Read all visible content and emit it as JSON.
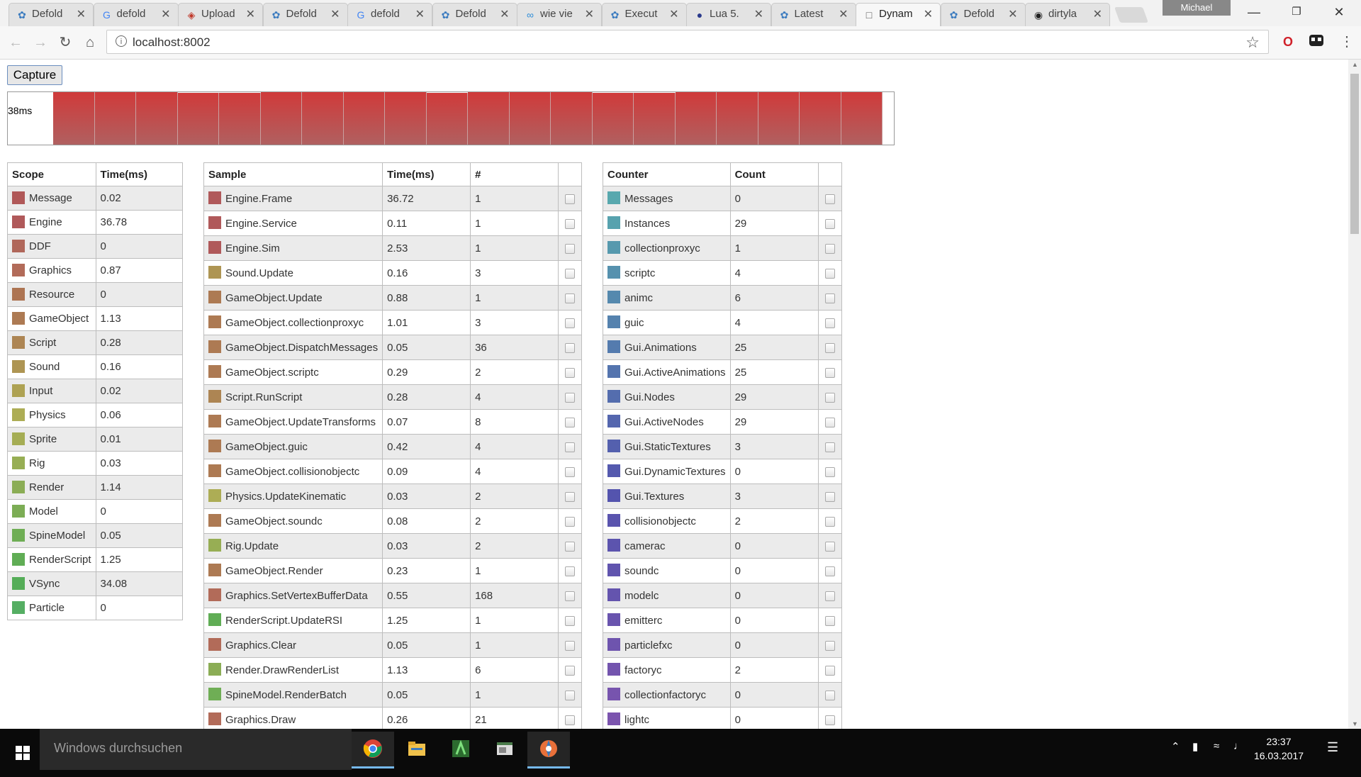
{
  "browser": {
    "tabs": [
      {
        "title": "Defold",
        "icon": "defold"
      },
      {
        "title": "defold",
        "icon": "google"
      },
      {
        "title": "Upload",
        "icon": "shield"
      },
      {
        "title": "Defold",
        "icon": "defold"
      },
      {
        "title": "defold",
        "icon": "google"
      },
      {
        "title": "Defold",
        "icon": "defold"
      },
      {
        "title": "wie vie",
        "icon": "infinity"
      },
      {
        "title": "Execut",
        "icon": "defold"
      },
      {
        "title": "Lua 5.",
        "icon": "lua"
      },
      {
        "title": "Latest",
        "icon": "defold"
      },
      {
        "title": "Dynam",
        "icon": "page"
      },
      {
        "title": "Defold",
        "icon": "defold"
      },
      {
        "title": "dirtyla",
        "icon": "github"
      }
    ],
    "active_tab_index": 10,
    "profile_name": "Michael",
    "url": "localhost:8002"
  },
  "profiler": {
    "capture_label": "Capture",
    "frame_label": "38ms",
    "frame_heights": [
      1,
      1,
      1,
      0.98,
      0.98,
      1,
      1,
      1,
      1,
      0.98,
      1,
      1,
      1,
      0.98,
      0.98,
      1,
      1,
      1,
      1,
      1
    ],
    "scope_table": {
      "headers": [
        "Scope",
        "Time(ms)"
      ],
      "rows": [
        {
          "name": "Message",
          "value": "0.02",
          "color": "#b05858"
        },
        {
          "name": "Engine",
          "value": "36.78",
          "color": "#b0595a"
        },
        {
          "name": "DDF",
          "value": "0",
          "color": "#b0675a"
        },
        {
          "name": "Graphics",
          "value": "0.87",
          "color": "#b26b59"
        },
        {
          "name": "Resource",
          "value": "0",
          "color": "#ad7452"
        },
        {
          "name": "GameObject",
          "value": "1.13",
          "color": "#ad7a53"
        },
        {
          "name": "Script",
          "value": "0.28",
          "color": "#ad8553"
        },
        {
          "name": "Sound",
          "value": "0.16",
          "color": "#ae9553"
        },
        {
          "name": "Input",
          "value": "0.02",
          "color": "#aea253"
        },
        {
          "name": "Physics",
          "value": "0.06",
          "color": "#adad55"
        },
        {
          "name": "Sprite",
          "value": "0.01",
          "color": "#a5ad54"
        },
        {
          "name": "Rig",
          "value": "0.03",
          "color": "#97ae54"
        },
        {
          "name": "Render",
          "value": "1.14",
          "color": "#8bad55"
        },
        {
          "name": "Model",
          "value": "0",
          "color": "#7cad55"
        },
        {
          "name": "SpineModel",
          "value": "0.05",
          "color": "#6fae55"
        },
        {
          "name": "RenderScript",
          "value": "1.25",
          "color": "#60ad55"
        },
        {
          "name": "VSync",
          "value": "34.08",
          "color": "#55ad58"
        },
        {
          "name": "Particle",
          "value": "0",
          "color": "#55ae63"
        }
      ]
    },
    "sample_table": {
      "headers": [
        "Sample",
        "Time(ms)",
        "#",
        ""
      ],
      "rows": [
        {
          "name": "Engine.Frame",
          "time": "36.72",
          "count": "1",
          "color": "#b0595a"
        },
        {
          "name": "Engine.Service",
          "time": "0.11",
          "count": "1",
          "color": "#b0595a"
        },
        {
          "name": "Engine.Sim",
          "time": "2.53",
          "count": "1",
          "color": "#b0595a"
        },
        {
          "name": "Sound.Update",
          "time": "0.16",
          "count": "3",
          "color": "#ae9553"
        },
        {
          "name": "GameObject.Update",
          "time": "0.88",
          "count": "1",
          "color": "#ad7a53"
        },
        {
          "name": "GameObject.collectionproxyc",
          "time": "1.01",
          "count": "3",
          "color": "#ad7a53"
        },
        {
          "name": "GameObject.DispatchMessages",
          "time": "0.05",
          "count": "36",
          "color": "#ad7a53"
        },
        {
          "name": "GameObject.scriptc",
          "time": "0.29",
          "count": "2",
          "color": "#ad7a53"
        },
        {
          "name": "Script.RunScript",
          "time": "0.28",
          "count": "4",
          "color": "#ad8553"
        },
        {
          "name": "GameObject.UpdateTransforms",
          "time": "0.07",
          "count": "8",
          "color": "#ad7a53"
        },
        {
          "name": "GameObject.guic",
          "time": "0.42",
          "count": "4",
          "color": "#ad7a53"
        },
        {
          "name": "GameObject.collisionobjectc",
          "time": "0.09",
          "count": "4",
          "color": "#ad7a53"
        },
        {
          "name": "Physics.UpdateKinematic",
          "time": "0.03",
          "count": "2",
          "color": "#adad55"
        },
        {
          "name": "GameObject.soundc",
          "time": "0.08",
          "count": "2",
          "color": "#ad7a53"
        },
        {
          "name": "Rig.Update",
          "time": "0.03",
          "count": "2",
          "color": "#97ae54"
        },
        {
          "name": "GameObject.Render",
          "time": "0.23",
          "count": "1",
          "color": "#ad7a53"
        },
        {
          "name": "Graphics.SetVertexBufferData",
          "time": "0.55",
          "count": "168",
          "color": "#b26b59"
        },
        {
          "name": "RenderScript.UpdateRSI",
          "time": "1.25",
          "count": "1",
          "color": "#60ad55"
        },
        {
          "name": "Graphics.Clear",
          "time": "0.05",
          "count": "1",
          "color": "#b26b59"
        },
        {
          "name": "Render.DrawRenderList",
          "time": "1.13",
          "count": "6",
          "color": "#8bad55"
        },
        {
          "name": "SpineModel.RenderBatch",
          "time": "0.05",
          "count": "1",
          "color": "#6fae55"
        },
        {
          "name": "Graphics.Draw",
          "time": "0.26",
          "count": "21",
          "color": "#b26b59"
        }
      ]
    },
    "counter_table": {
      "headers": [
        "Counter",
        "Count",
        ""
      ],
      "rows": [
        {
          "name": "Messages",
          "value": "0",
          "color": "#58a8ae"
        },
        {
          "name": "Instances",
          "value": "29",
          "color": "#57a2ae"
        },
        {
          "name": "collectionproxyc",
          "value": "1",
          "color": "#5699ae"
        },
        {
          "name": "scriptc",
          "value": "4",
          "color": "#5691ae"
        },
        {
          "name": "animc",
          "value": "6",
          "color": "#5589ae"
        },
        {
          "name": "guic",
          "value": "4",
          "color": "#5582ae"
        },
        {
          "name": "Gui.Animations",
          "value": "25",
          "color": "#547bae"
        },
        {
          "name": "Gui.ActiveAnimations",
          "value": "25",
          "color": "#5474ae"
        },
        {
          "name": "Gui.Nodes",
          "value": "29",
          "color": "#546dae"
        },
        {
          "name": "Gui.ActiveNodes",
          "value": "29",
          "color": "#5466ae"
        },
        {
          "name": "Gui.StaticTextures",
          "value": "3",
          "color": "#5460ae"
        },
        {
          "name": "Gui.DynamicTextures",
          "value": "0",
          "color": "#5459ae"
        },
        {
          "name": "Gui.Textures",
          "value": "3",
          "color": "#5454ae"
        },
        {
          "name": "collisionobjectc",
          "value": "2",
          "color": "#5a54ae"
        },
        {
          "name": "camerac",
          "value": "0",
          "color": "#5c54ae"
        },
        {
          "name": "soundc",
          "value": "0",
          "color": "#6054ae"
        },
        {
          "name": "modelc",
          "value": "0",
          "color": "#6454ae"
        },
        {
          "name": "emitterc",
          "value": "0",
          "color": "#6954ae"
        },
        {
          "name": "particlefxc",
          "value": "0",
          "color": "#6e54ae"
        },
        {
          "name": "factoryc",
          "value": "2",
          "color": "#7354ae"
        },
        {
          "name": "collectionfactoryc",
          "value": "0",
          "color": "#7754ae"
        },
        {
          "name": "lightc",
          "value": "0",
          "color": "#7b54ae"
        }
      ]
    }
  },
  "taskbar": {
    "search_placeholder": "Windows durchsuchen",
    "apps": [
      {
        "name": "chrome",
        "active": true
      },
      {
        "name": "file-explorer",
        "active": false
      },
      {
        "name": "editor-green",
        "active": false
      },
      {
        "name": "window-app",
        "active": false
      },
      {
        "name": "defold-app",
        "active": true
      }
    ],
    "time": "23:37",
    "date": "16.03.2017"
  }
}
